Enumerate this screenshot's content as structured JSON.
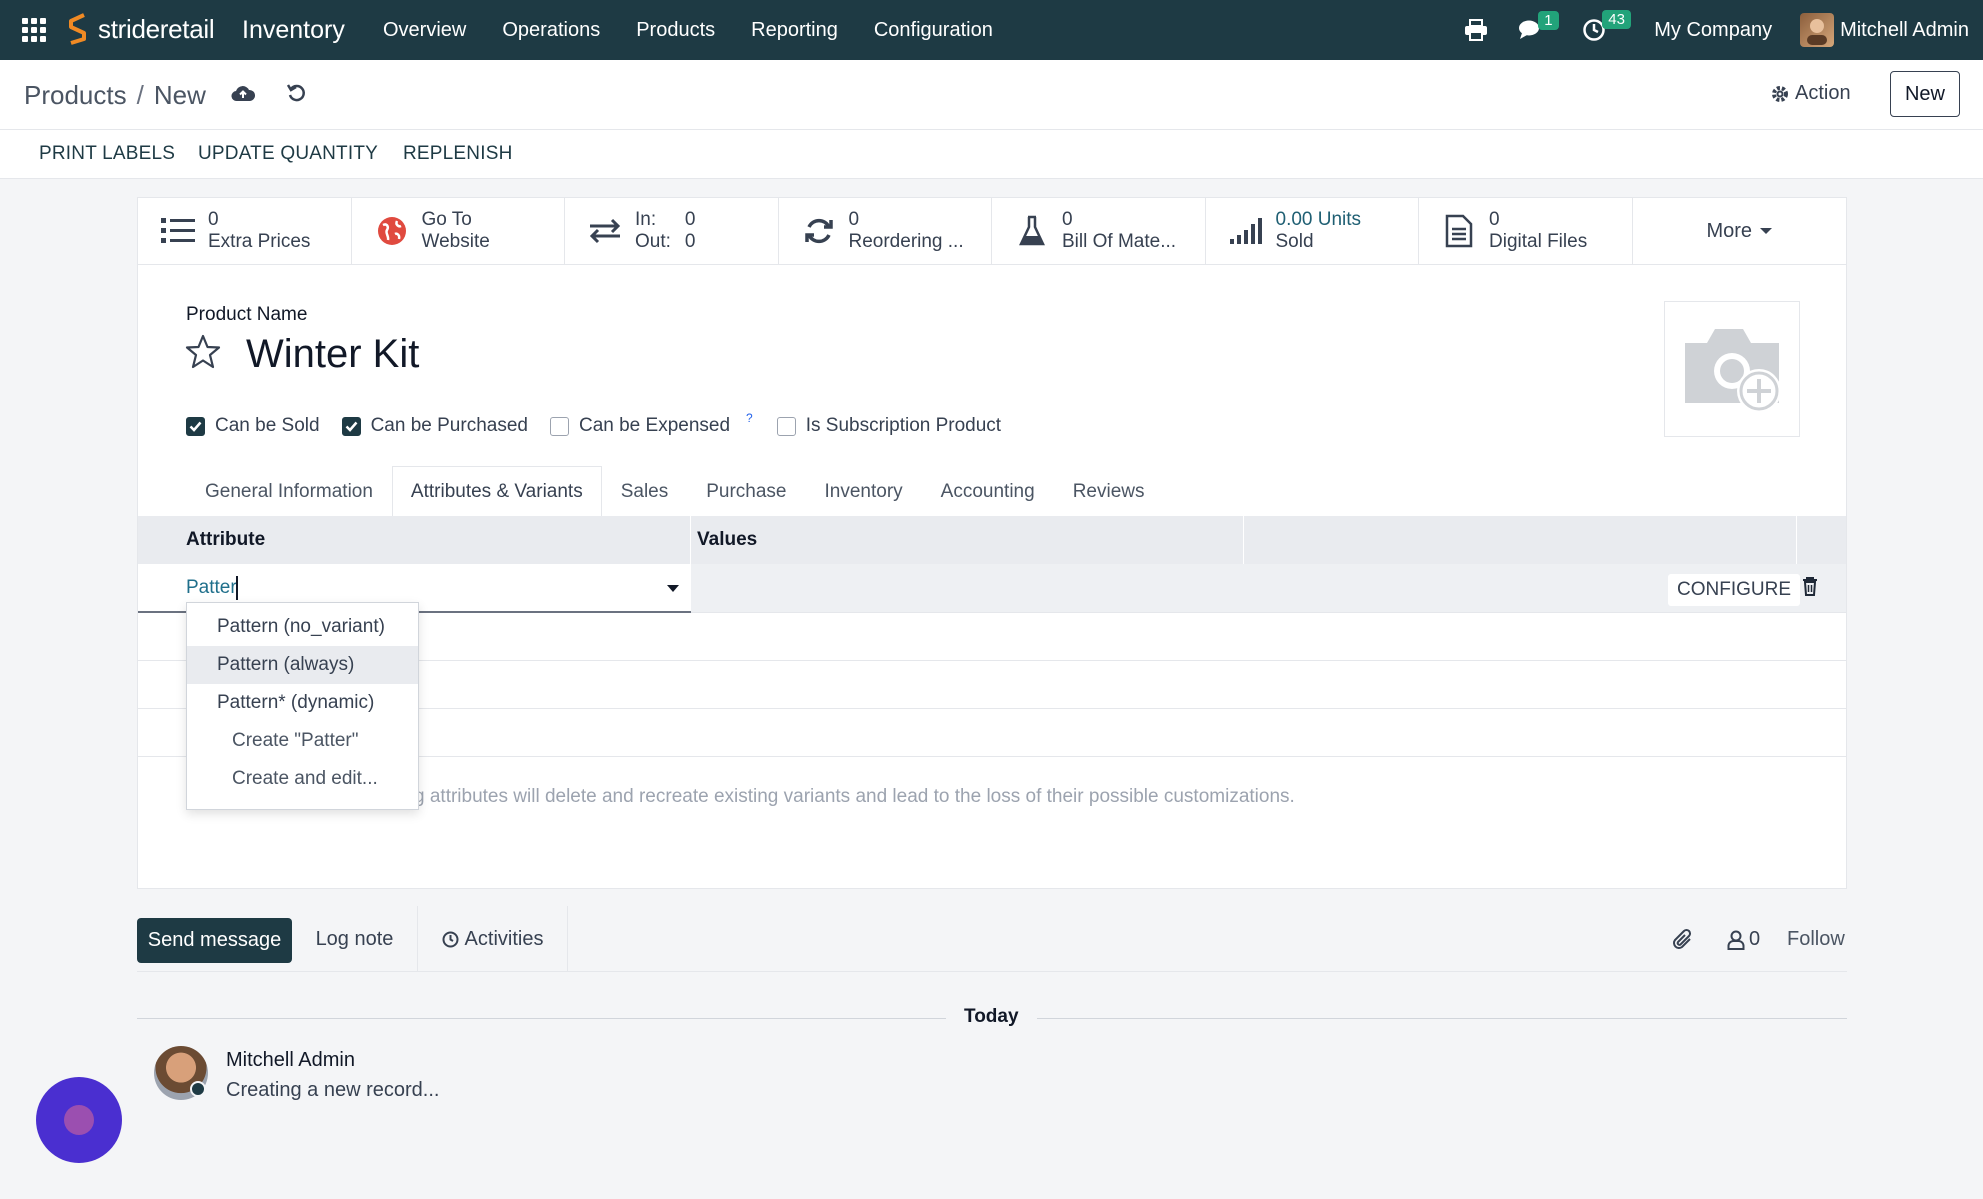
{
  "navbar": {
    "brand": "strideretail",
    "app": "Inventory",
    "menu": [
      "Overview",
      "Operations",
      "Products",
      "Reporting",
      "Configuration"
    ],
    "messages_badge": "1",
    "activities_badge": "43",
    "company": "My Company",
    "user": "Mitchell Admin"
  },
  "control": {
    "breadcrumb_parent": "Products",
    "breadcrumb_sep": "/",
    "breadcrumb_current": "New",
    "action_label": "Action",
    "new_label": "New"
  },
  "status_buttons": [
    "PRINT LABELS",
    "UPDATE QUANTITY",
    "REPLENISH"
  ],
  "smart_buttons": {
    "extra_prices": {
      "value": "0",
      "label": "Extra Prices"
    },
    "website": {
      "line1": "Go To",
      "line2": "Website"
    },
    "in_out": {
      "in_label": "In:",
      "in_value": "0",
      "out_label": "Out:",
      "out_value": "0"
    },
    "reordering": {
      "value": "0",
      "label": "Reordering ..."
    },
    "bom": {
      "value": "0",
      "label": "Bill Of Mate..."
    },
    "sold": {
      "value": "0.00 Units",
      "label": "Sold"
    },
    "files": {
      "value": "0",
      "label": "Digital Files"
    },
    "more": "More"
  },
  "form": {
    "product_name_label": "Product Name",
    "product_name": "Winter Kit",
    "checkboxes": [
      {
        "label": "Can be Sold",
        "checked": true
      },
      {
        "label": "Can be Purchased",
        "checked": true
      },
      {
        "label": "Can be Expensed",
        "checked": false
      },
      {
        "label": "Is Subscription Product",
        "checked": false
      }
    ],
    "help_mark": "?",
    "tabs": [
      "General Information",
      "Attributes & Variants",
      "Sales",
      "Purchase",
      "Inventory",
      "Accounting",
      "Reviews"
    ],
    "active_tab": "Attributes & Variants"
  },
  "attributes_grid": {
    "headers": [
      "Attribute",
      "Values"
    ],
    "input_value": "Patter",
    "configure_label": "CONFIGURE",
    "note": "Warning: adding or deleting attributes will delete and recreate existing variants and lead to the loss of their possible customizations.",
    "note_visible": "g attributes will delete and recreate existing variants and lead to the loss of their possible customizations."
  },
  "autocomplete": {
    "options": [
      "Pattern (no_variant)",
      "Pattern (always)",
      "Pattern* (dynamic)"
    ],
    "highlighted_index": 1,
    "create_label": "Create \"Patter\"",
    "create_edit_label": "Create and edit..."
  },
  "chatter": {
    "send_message": "Send message",
    "log_note": "Log note",
    "activities": "Activities",
    "followers_count": "0",
    "follow": "Follow",
    "today": "Today",
    "author": "Mitchell Admin",
    "message": "Creating a new record..."
  },
  "colors": {
    "navbar": "#1e3a44",
    "accent": "#1e3a44",
    "badge": "#22a37a",
    "fab": "#4a2fd0"
  }
}
